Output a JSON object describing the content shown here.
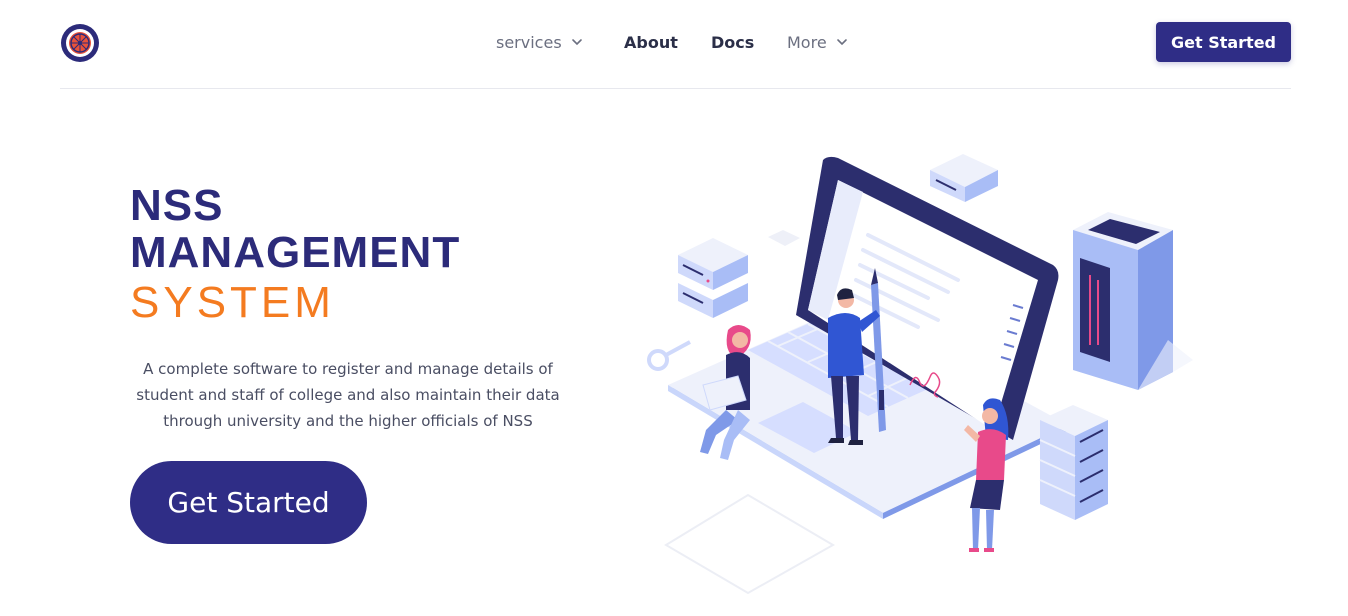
{
  "nav": {
    "logo_icon": "nss-logo-icon",
    "items": [
      {
        "label": "services",
        "has_dropdown": true
      },
      {
        "label": "About",
        "has_dropdown": false
      },
      {
        "label": "Docs",
        "has_dropdown": false
      },
      {
        "label": "More",
        "has_dropdown": true
      }
    ],
    "cta_label": "Get Started"
  },
  "hero": {
    "title_line1": "NSS",
    "title_line2": "MANAGEMENT",
    "title_line3": "SYSTEM",
    "description": "A complete software to register and manage details of student and staff of college and also maintain their data through university and the higher officials of NSS",
    "cta_label": "Get Started"
  },
  "colors": {
    "primary": "#2f2d86",
    "accent": "#f47b20",
    "text": "#4a4e63"
  }
}
